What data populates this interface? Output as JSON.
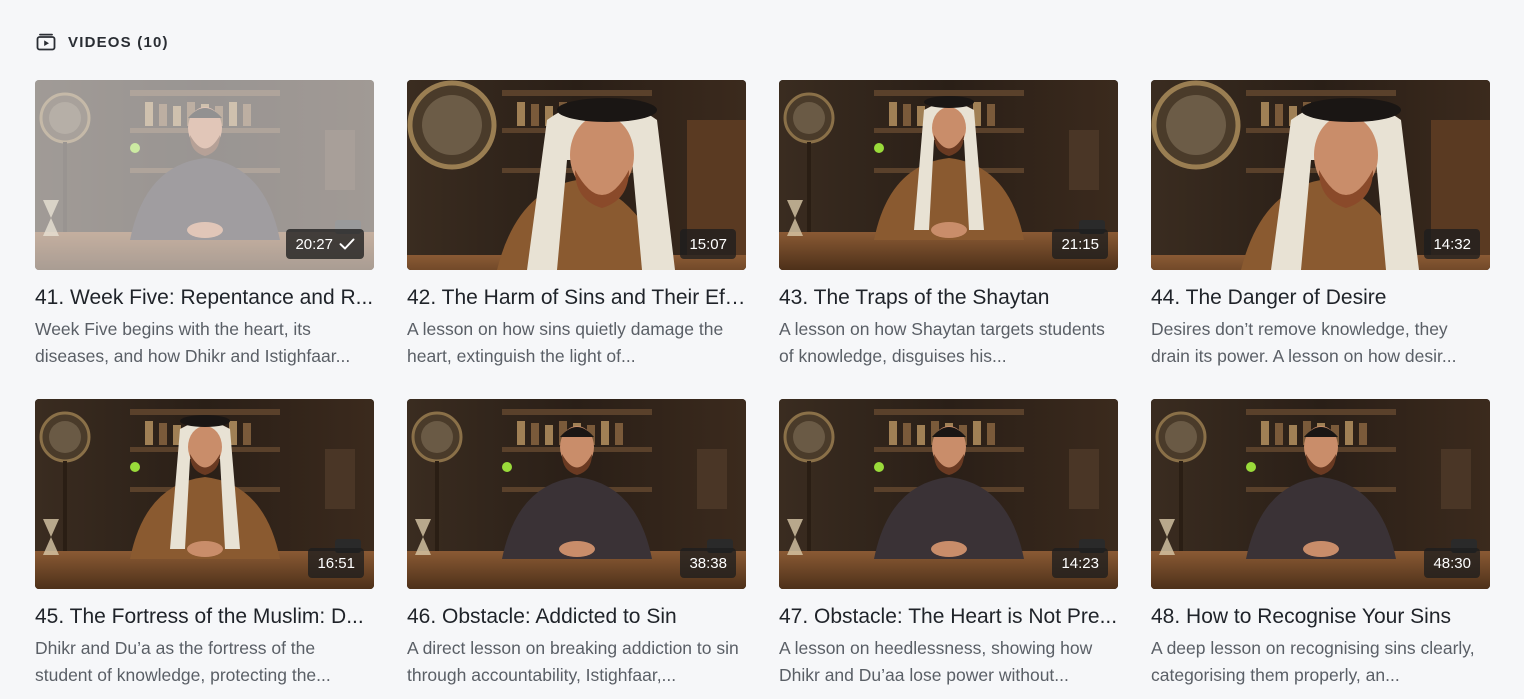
{
  "section": {
    "title": "VIDEOS (10)",
    "icon": "video-playlist-icon"
  },
  "colors": {
    "background": "#f6f7f9",
    "title_text": "#1f2329",
    "desc_text": "#5a5f66",
    "duration_bg": "#1e1e1e"
  },
  "videos": [
    {
      "title": "41. Week Five: Repentance and R...",
      "description": "Week Five begins with the heart, its diseases, and how Dhikr and Istighfaar...",
      "duration": "20:27",
      "watched": true,
      "presenter": "cap",
      "shot": "wide"
    },
    {
      "title": "42. The Harm of Sins and Their Eff...",
      "description": "A lesson on how sins quietly damage the heart, extinguish the light of...",
      "duration": "15:07",
      "watched": false,
      "presenter": "shemagh",
      "shot": "close"
    },
    {
      "title": "43. The Traps of the Shaytan",
      "description": "A lesson on how Shaytan targets students of knowledge, disguises his...",
      "duration": "21:15",
      "watched": false,
      "presenter": "shemagh",
      "shot": "wide"
    },
    {
      "title": "44. The Danger of Desire",
      "description": "Desires don’t remove knowledge, they drain its power. A lesson on how desir...",
      "duration": "14:32",
      "watched": false,
      "presenter": "shemagh",
      "shot": "close"
    },
    {
      "title": "45. The Fortress of the Muslim: D...",
      "description": "Dhikr and Du’a as the fortress of the student of knowledge, protecting the...",
      "duration": "16:51",
      "watched": false,
      "presenter": "shemagh",
      "shot": "wide"
    },
    {
      "title": "46. Obstacle: Addicted to Sin",
      "description": "A direct lesson on breaking addiction to sin through accountability, Istighfaar,...",
      "duration": "38:38",
      "watched": false,
      "presenter": "cap",
      "shot": "wide"
    },
    {
      "title": "47. Obstacle: The Heart is Not Pre...",
      "description": "A lesson on heedlessness, showing how Dhikr and Du’aa lose power without...",
      "duration": "14:23",
      "watched": false,
      "presenter": "cap",
      "shot": "wide"
    },
    {
      "title": "48. How to Recognise Your Sins",
      "description": "A deep lesson on recognising sins clearly, categorising them properly, an...",
      "duration": "48:30",
      "watched": false,
      "presenter": "cap",
      "shot": "wide"
    }
  ]
}
